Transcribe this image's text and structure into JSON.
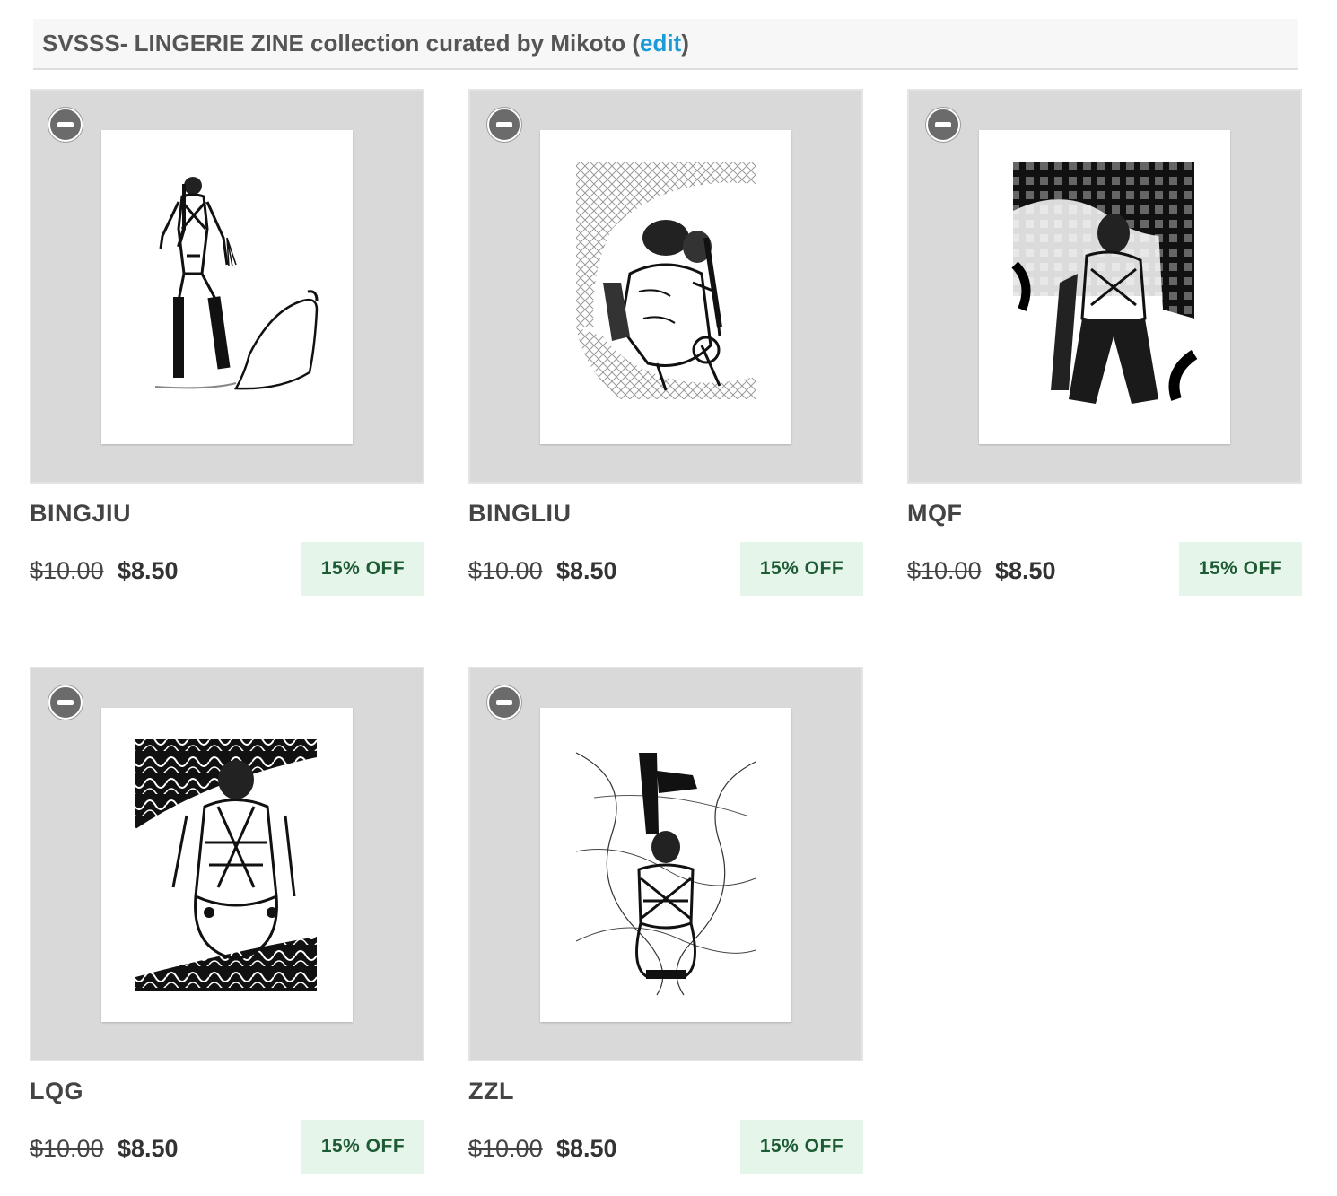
{
  "collection": {
    "title_text": "SVSSS- LINGERIE ZINE collection curated by Mikoto (",
    "edit_label": "edit",
    "title_close": ")"
  },
  "products": [
    {
      "name": "BINGJIU",
      "old_price": "$10.00",
      "price": "$8.50",
      "discount": "15% OFF"
    },
    {
      "name": "BINGLIU",
      "old_price": "$10.00",
      "price": "$8.50",
      "discount": "15% OFF"
    },
    {
      "name": "MQF",
      "old_price": "$10.00",
      "price": "$8.50",
      "discount": "15% OFF"
    },
    {
      "name": "LQG",
      "old_price": "$10.00",
      "price": "$8.50",
      "discount": "15% OFF"
    },
    {
      "name": "ZZL",
      "old_price": "$10.00",
      "price": "$8.50",
      "discount": "15% OFF"
    }
  ],
  "icons": {
    "remove": "minus-circle-icon"
  },
  "colors": {
    "link": "#1a9cd8",
    "badge_bg": "#e6f5ea",
    "badge_text": "#1d5b34",
    "frame_bg": "#d9d9d9"
  }
}
